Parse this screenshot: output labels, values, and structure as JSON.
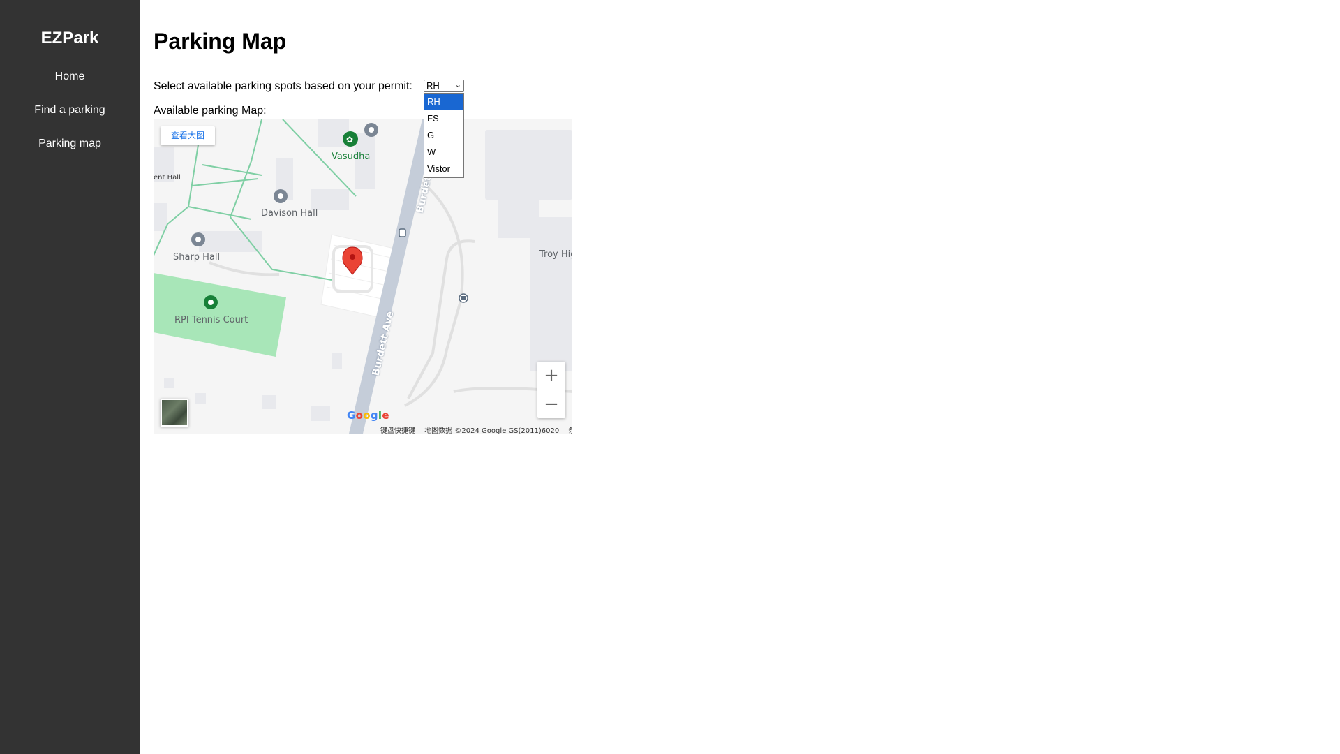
{
  "sidebar": {
    "brand": "EZPark",
    "items": [
      {
        "label": "Home"
      },
      {
        "label": "Find a parking"
      },
      {
        "label": "Parking map"
      }
    ]
  },
  "page": {
    "title": "Parking Map",
    "permit_label": "Select available parking spots based on your permit:",
    "permit_selected": "RH",
    "permit_options": [
      "RH",
      "FS",
      "G",
      "W",
      "Vistor"
    ],
    "map_label": "Available parking Map:"
  },
  "map": {
    "view_larger": "查看大图",
    "labels": {
      "vasudha": "Vasudha",
      "davison": "Davison Hall",
      "sharp": "Sharp Hall",
      "tennis": "RPI Tennis Court",
      "troy": "Troy Hig",
      "ent_hall": "ent Hall",
      "street1": "Burdett Ave",
      "street2": "Burdett Ave"
    },
    "google": "Google",
    "attribution": {
      "shortcuts": "键盘快捷键",
      "data": "地图数据 ©2024 Google GS(2011)6020",
      "terms": "条款"
    },
    "zoom_in": "+",
    "zoom_out": "−"
  },
  "colors": {
    "sidebar_bg": "#333333",
    "map_bg": "#f5f5f5",
    "tennis_green": "#a8e6b8",
    "marker_red": "#ea4335",
    "road": "#c5cdd9",
    "path_green": "#7fcfa4",
    "selected_option": "#1967d2"
  },
  "icons": [
    "marker-pin-icon",
    "poi-pin-icon",
    "bus-stop-icon",
    "zoom-in-icon",
    "zoom-out-icon",
    "chevron-down-icon"
  ]
}
